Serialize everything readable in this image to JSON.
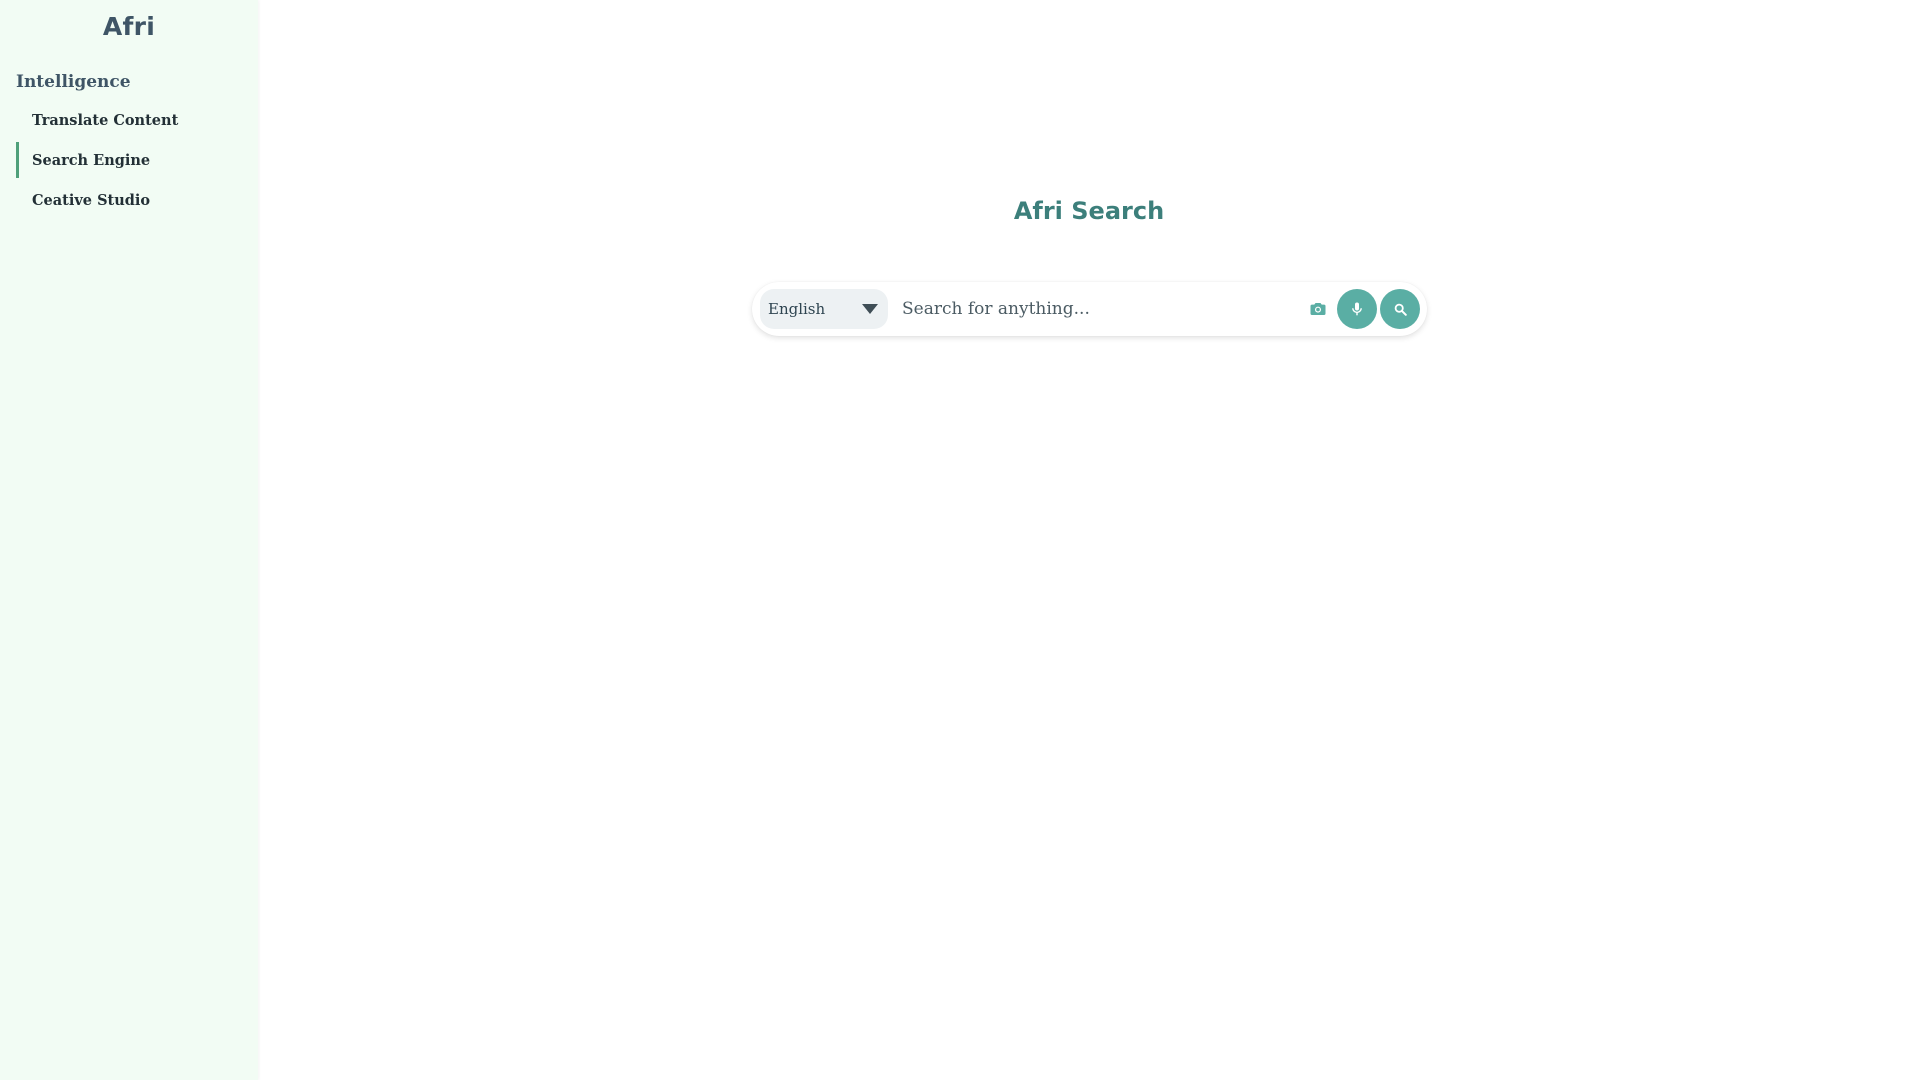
{
  "sidebar": {
    "brand": "Afri",
    "section_title": "Intelligence",
    "items": [
      {
        "label": "Translate Content",
        "active": false
      },
      {
        "label": "Search Engine",
        "active": true
      },
      {
        "label": "Ceative Studio",
        "active": false
      }
    ]
  },
  "main": {
    "title": "Afri Search",
    "search": {
      "language": "English",
      "placeholder": "Search for anything...",
      "value": ""
    }
  },
  "icons": {
    "caret": "chevron-down-icon",
    "camera": "camera-icon",
    "mic": "microphone-icon",
    "search": "search-icon"
  },
  "colors": {
    "accent": "#5aaea4",
    "title": "#3c7f7b",
    "sidebar_bg": "#f2fcf4",
    "active_indicator": "#4fa07a"
  }
}
